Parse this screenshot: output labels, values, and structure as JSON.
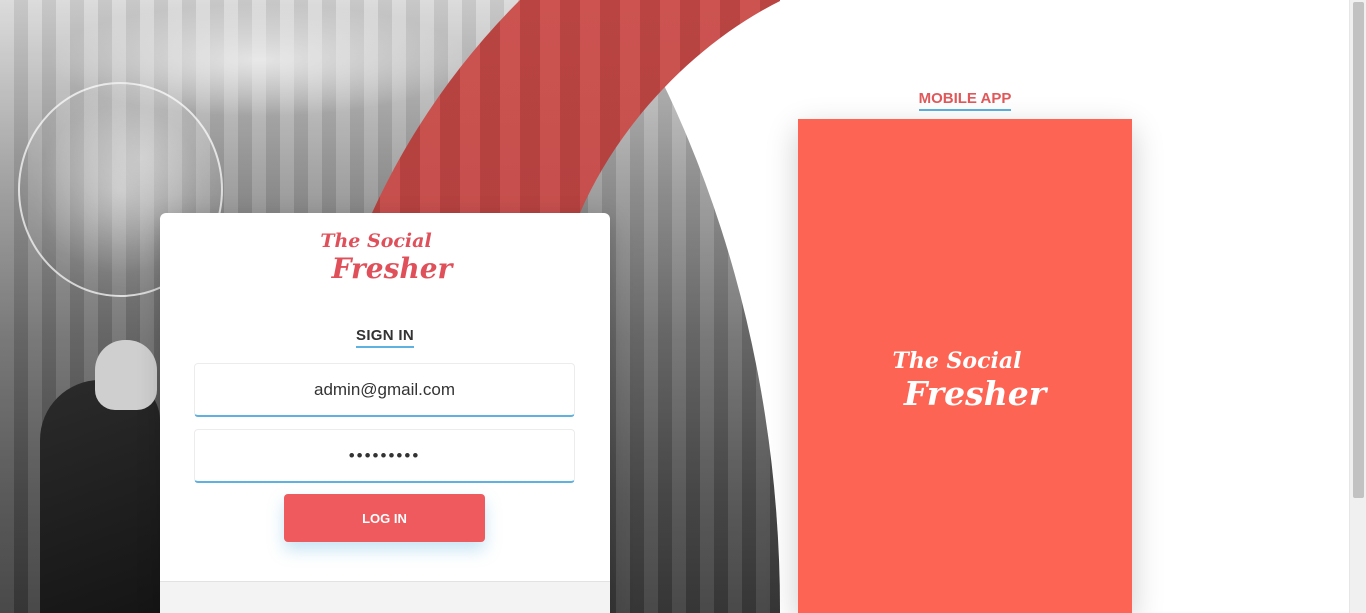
{
  "login": {
    "logo_line1": "The Social",
    "logo_line2": "Fresher",
    "heading": "SIGN IN",
    "email_value": "admin@gmail.com",
    "password_value": "•••••••••",
    "login_button": "LOG IN"
  },
  "mobile_app": {
    "title": "MOBILE APP",
    "logo_line1": "The Social",
    "logo_line2": "Fresher"
  },
  "colors": {
    "accent_red": "#ee5a5e",
    "phone_bg": "#fe6454",
    "underline_blue": "#5fb1e0"
  }
}
